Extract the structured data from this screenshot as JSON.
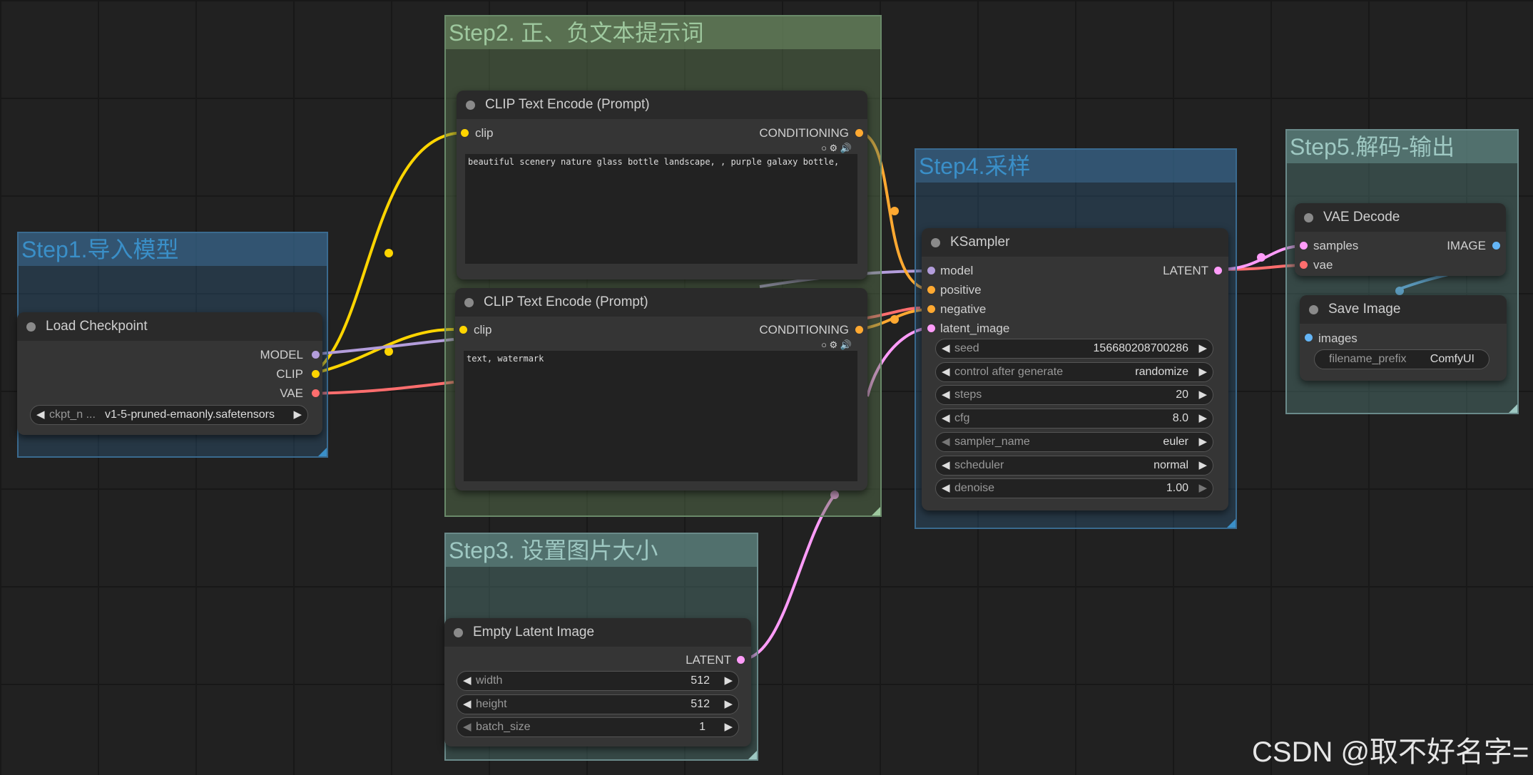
{
  "groups": {
    "step1": "Step1.导入模型",
    "step2": "Step2. 正、负文本提示词",
    "step3": "Step3. 设置图片大小",
    "step4": "Step4.采样",
    "step5": "Step5.解码-输出"
  },
  "load_checkpoint": {
    "title": "Load Checkpoint",
    "outputs": [
      "MODEL",
      "CLIP",
      "VAE"
    ],
    "ckpt_label": "ckpt_n ...",
    "ckpt_value": "v1-5-pruned-emaonly.safetensors"
  },
  "clip_pos": {
    "title": "CLIP Text Encode (Prompt)",
    "input": "clip",
    "output": "CONDITIONING",
    "icons": "○ ⚙ 🔊",
    "text": "beautiful scenery nature glass bottle landscape, , purple galaxy bottle,"
  },
  "clip_neg": {
    "title": "CLIP Text Encode (Prompt)",
    "input": "clip",
    "output": "CONDITIONING",
    "icons": "○ ⚙ 🔊",
    "text": "text, watermark"
  },
  "empty_latent": {
    "title": "Empty Latent Image",
    "output": "LATENT",
    "widgets": [
      {
        "label": "width",
        "value": "512"
      },
      {
        "label": "height",
        "value": "512"
      },
      {
        "label": "batch_size",
        "value": "1"
      }
    ]
  },
  "ksampler": {
    "title": "KSampler",
    "inputs": [
      "model",
      "positive",
      "negative",
      "latent_image"
    ],
    "output": "LATENT",
    "widgets": [
      {
        "label": "seed",
        "value": "156680208700286"
      },
      {
        "label": "control after generate",
        "value": "randomize"
      },
      {
        "label": "steps",
        "value": "20"
      },
      {
        "label": "cfg",
        "value": "8.0"
      },
      {
        "label": "sampler_name",
        "value": "euler"
      },
      {
        "label": "scheduler",
        "value": "normal"
      },
      {
        "label": "denoise",
        "value": "1.00"
      }
    ]
  },
  "vae_decode": {
    "title": "VAE Decode",
    "inputs": [
      "samples",
      "vae"
    ],
    "output": "IMAGE"
  },
  "save_image": {
    "title": "Save Image",
    "input": "images",
    "prefix_label": "filename_prefix",
    "prefix_value": "ComfyUI"
  },
  "watermark": "CSDN @取不好名字=",
  "colors": {
    "model": "#b39ddb",
    "clip": "#ffd500",
    "vae": "#ff6e6e",
    "conditioning": "#ffa931",
    "latent": "#ff9cf9",
    "image": "#64b5f6"
  }
}
